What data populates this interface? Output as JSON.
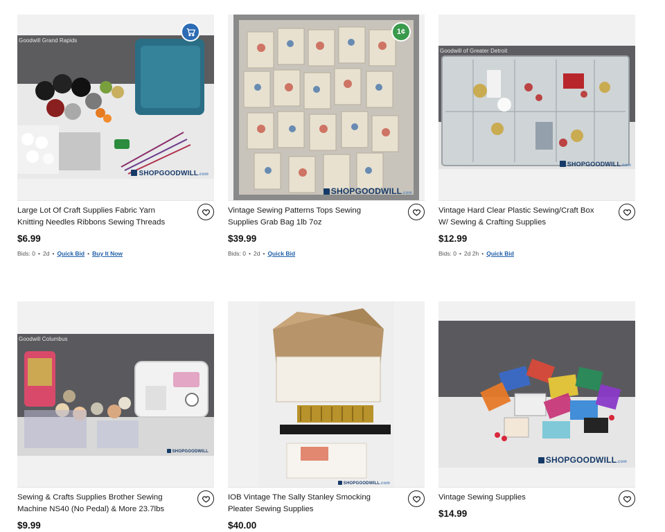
{
  "listings": [
    {
      "location": "Goodwill Grand Rapids",
      "title": "Large Lot Of Craft Supplies Fabric Yarn Knitting Needles Ribbons Sewing Threads",
      "price": "$6.99",
      "bids": "Bids: 0",
      "time": "2d",
      "quick_bid": "Quick Bid",
      "buy_now": "Buy It Now",
      "badge": "cart-icon",
      "watermark": "SHOPGOODWILL",
      "watermark_suffix": ".com"
    },
    {
      "location": "",
      "title": "Vintage Sewing Patterns Tops Sewing Supplies Grab Bag 1lb 7oz",
      "price": "$39.99",
      "bids": "Bids: 0",
      "time": "2d",
      "quick_bid": "Quick Bid",
      "badge": "cent-icon",
      "badge_text": "1¢",
      "watermark": "SHOPGOODWILL",
      "watermark_suffix": ".com"
    },
    {
      "location": "Goodwill of Greater Detroit",
      "title": "Vintage Hard Clear Plastic Sewing/Craft Box W/ Sewing & Crafting Supplies",
      "price": "$12.99",
      "bids": "Bids: 0",
      "time": "2d 2h",
      "quick_bid": "Quick Bid",
      "watermark": "SHOPGOODWILL",
      "watermark_suffix": ".com"
    },
    {
      "location": "Goodwill Columbus",
      "title": "Sewing & Crafts Supplies Brother Sewing Machine NS40 (No Pedal) & More 23.7lbs",
      "price": "$9.99",
      "watermark": "SHOPGOODWILL"
    },
    {
      "location": "",
      "title": "IOB Vintage The Sally Stanley Smocking Pleater Sewing Supplies",
      "price": "$40.00",
      "watermark": "SHOPGOODWILL",
      "watermark_suffix": ".com"
    },
    {
      "location": "",
      "title": "Vintage Sewing Supplies",
      "price": "$14.99",
      "watermark": "SHOPGOODWILL",
      "watermark_suffix": ".com"
    }
  ],
  "colors": {
    "link": "#1f5fa8",
    "cart_badge": "#2d6cb5",
    "cent_badge": "#3a9a4c"
  }
}
